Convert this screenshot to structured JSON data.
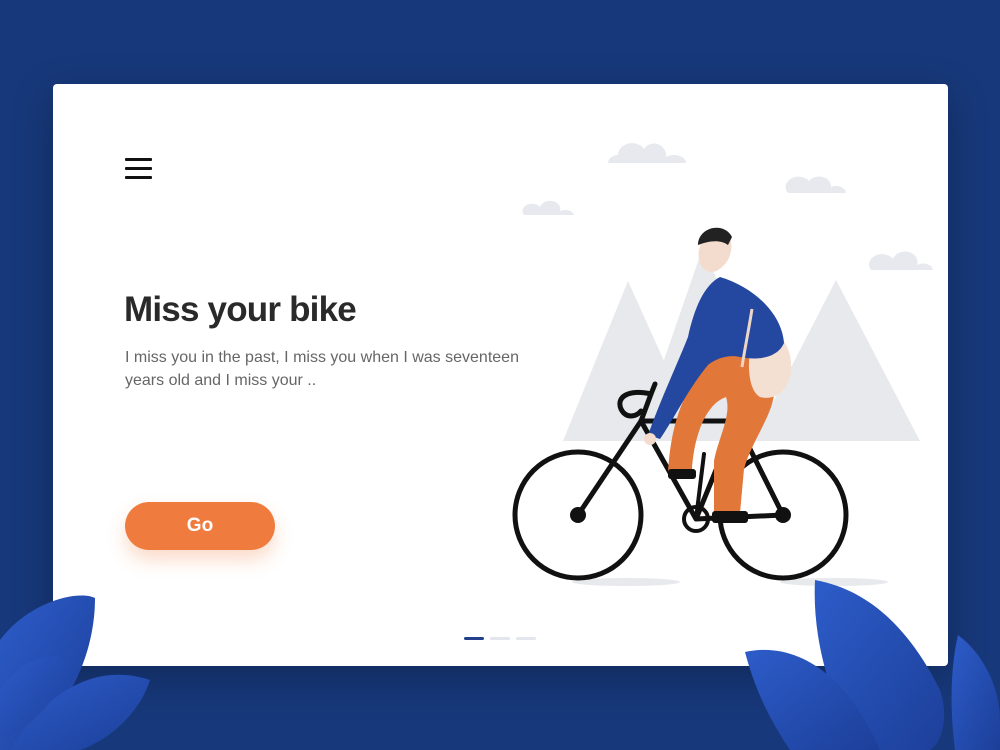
{
  "hero": {
    "title": "Miss your bike",
    "description": "I miss you in the past, I miss you when I was seventeen years old and I miss your ..",
    "go_label": "Go"
  },
  "pagination": {
    "total": 3,
    "active": 1
  },
  "icons": {
    "menu": "hamburger-menu-icon"
  },
  "colors": {
    "background": "#17387a",
    "card": "#ffffff",
    "accent": "#ef7c3e",
    "leaf": "#2a52b8",
    "jacket": "#2447a0",
    "trousers": "#e2773a"
  }
}
